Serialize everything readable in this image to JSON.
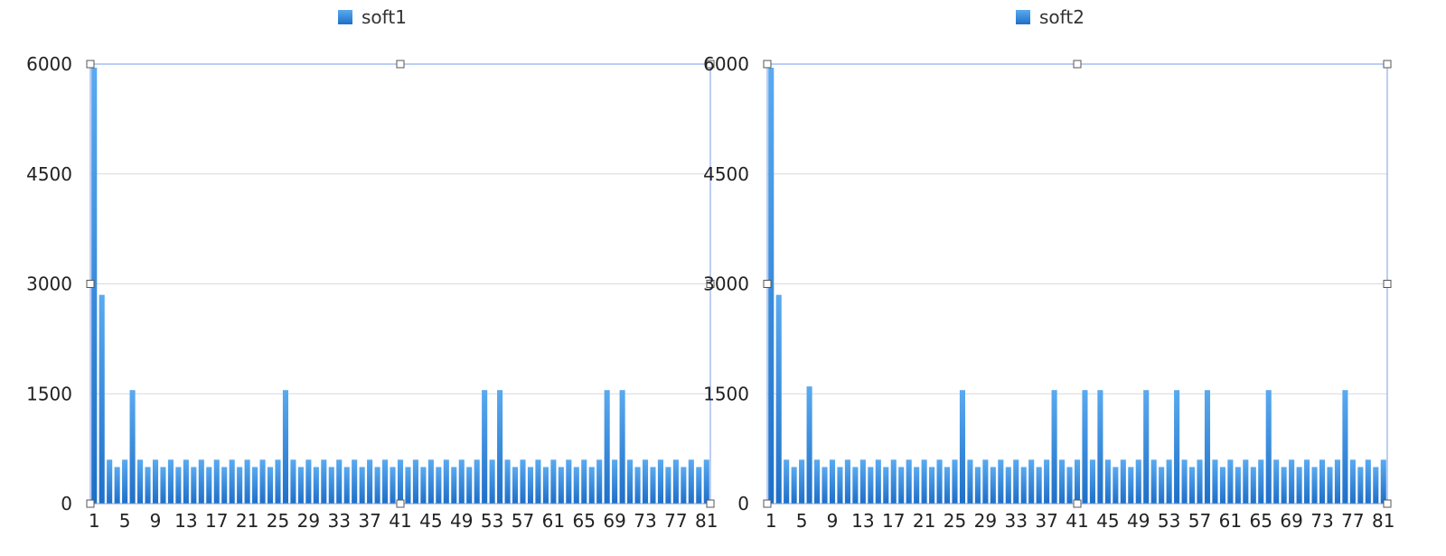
{
  "colors": {
    "bar_top": "#5aaaf0",
    "bar_bottom": "#1e6fc8",
    "selection": "#7a9de8",
    "grid": "#d9d9d9"
  },
  "chart_data": [
    {
      "type": "bar",
      "legend": "soft1",
      "legend_position": "top",
      "grid": true,
      "ylim": [
        0,
        6000
      ],
      "y_ticks": [
        "0",
        "1500",
        "3000",
        "4500",
        "6000"
      ],
      "x_ticks": [
        "1",
        "5",
        "9",
        "13",
        "17",
        "21",
        "25",
        "29",
        "33",
        "37",
        "41",
        "45",
        "49",
        "53",
        "57",
        "61",
        "65",
        "69",
        "73",
        "77",
        "81"
      ],
      "series": [
        {
          "name": "soft1",
          "values": [
            5950,
            2850,
            600,
            500,
            600,
            1550,
            600,
            500,
            600,
            500,
            600,
            500,
            600,
            500,
            600,
            500,
            600,
            500,
            600,
            500,
            600,
            500,
            600,
            500,
            600,
            1550,
            600,
            500,
            600,
            500,
            600,
            500,
            600,
            500,
            600,
            500,
            600,
            500,
            600,
            500,
            600,
            500,
            600,
            500,
            600,
            500,
            600,
            500,
            600,
            500,
            600,
            1550,
            600,
            1550,
            600,
            500,
            600,
            500,
            600,
            500,
            600,
            500,
            600,
            500,
            600,
            500,
            600,
            1550,
            600,
            1550,
            600,
            500,
            600,
            500,
            600,
            500,
            600,
            500,
            600,
            500,
            600
          ]
        }
      ]
    },
    {
      "type": "bar",
      "legend": "soft2",
      "legend_position": "top",
      "grid": true,
      "ylim": [
        0,
        6000
      ],
      "y_ticks": [
        "0",
        "1500",
        "3000",
        "4500",
        "6000"
      ],
      "x_ticks": [
        "1",
        "5",
        "9",
        "13",
        "17",
        "21",
        "25",
        "29",
        "33",
        "37",
        "41",
        "45",
        "49",
        "53",
        "57",
        "61",
        "65",
        "69",
        "73",
        "77",
        "81"
      ],
      "series": [
        {
          "name": "soft2",
          "values": [
            5950,
            2850,
            600,
            500,
            600,
            1600,
            600,
            500,
            600,
            500,
            600,
            500,
            600,
            500,
            600,
            500,
            600,
            500,
            600,
            500,
            600,
            500,
            600,
            500,
            600,
            1550,
            600,
            500,
            600,
            500,
            600,
            500,
            600,
            500,
            600,
            500,
            600,
            1550,
            600,
            500,
            600,
            1550,
            600,
            1550,
            600,
            500,
            600,
            500,
            600,
            1550,
            600,
            500,
            600,
            1550,
            600,
            500,
            600,
            1550,
            600,
            500,
            600,
            500,
            600,
            500,
            600,
            1550,
            600,
            500,
            600,
            500,
            600,
            500,
            600,
            500,
            600,
            1550,
            600,
            500,
            600,
            500,
            600
          ]
        }
      ]
    }
  ]
}
